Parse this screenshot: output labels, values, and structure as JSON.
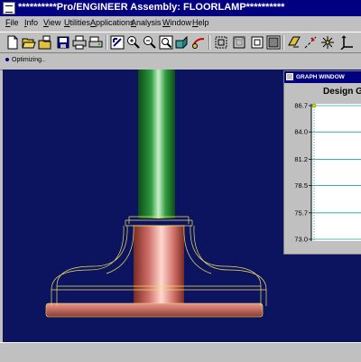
{
  "window": {
    "title": "**********Pro/ENGINEER Assembly: FLOORLAMP**********"
  },
  "menu": [
    "File",
    "Info",
    "View",
    "Utilities",
    "Applications",
    "Analysis",
    "Window",
    "Help"
  ],
  "toolbar": [
    "new-icon",
    "open-icon",
    "open-set-icon",
    "save-icon",
    "print-icon",
    "print-setup-icon",
    "view-icon",
    "zoom-in-icon",
    "zoom-out-icon",
    "refit-icon",
    "orient-icon",
    "repaint-icon",
    "wireframe-icon",
    "hidden-line-icon",
    "no-hidden-icon",
    "shade-icon",
    "datum-plane-icon",
    "datum-axis-icon",
    "datum-point-icon",
    "coord-sys-icon"
  ],
  "status": {
    "message": "Optimizing.."
  },
  "graph": {
    "title": "GRAPH WINDOW",
    "heading": "Design G",
    "y_ticks": [
      "86.7",
      "84.0",
      "81.2",
      "78.5",
      "75.7",
      "73.0"
    ]
  },
  "chart_data": {
    "type": "line",
    "title": "Design G",
    "ylim": [
      73.0,
      86.7
    ],
    "y_ticks": [
      86.7,
      84.0,
      81.2,
      78.5,
      75.7,
      73.0
    ],
    "points": [
      {
        "x": 0,
        "y": 86.7
      }
    ]
  },
  "colors": {
    "viewport_bg": "#0c1460",
    "title_bar": "#000080",
    "rod_green": "#2e9a3e",
    "base_salmon": "#d07068",
    "wire_yellow": "#f0e060",
    "graph_line": "#20a0a0"
  }
}
